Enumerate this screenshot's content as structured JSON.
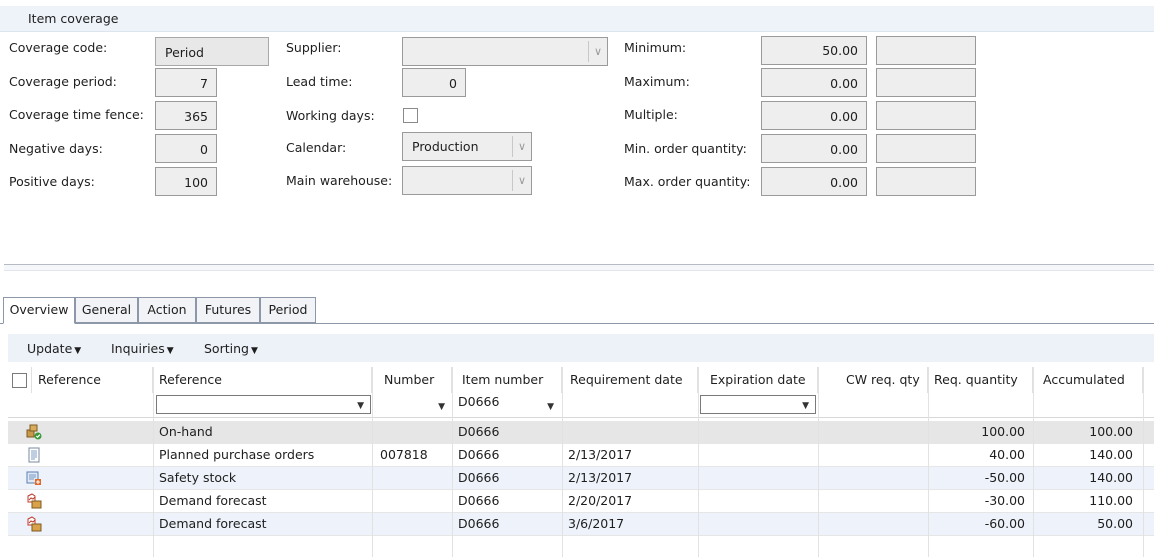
{
  "section": {
    "title": "Item coverage"
  },
  "coverage": {
    "coverage_code_label": "Coverage code:",
    "coverage_code": "Period",
    "coverage_period_label": "Coverage period:",
    "coverage_period": "7",
    "time_fence_label": "Coverage time fence:",
    "time_fence": "365",
    "negative_days_label": "Negative days:",
    "negative_days": "0",
    "positive_days_label": "Positive days:",
    "positive_days": "100"
  },
  "supply": {
    "supplier_label": "Supplier:",
    "supplier": "",
    "lead_time_label": "Lead time:",
    "lead_time": "0",
    "working_days_label": "Working days:",
    "working_days_checked": false,
    "calendar_label": "Calendar:",
    "calendar": "Production",
    "main_warehouse_label": "Main warehouse:",
    "main_warehouse": ""
  },
  "quantities": {
    "minimum_label": "Minimum:",
    "minimum": "50.00",
    "maximum_label": "Maximum:",
    "maximum": "0.00",
    "multiple_label": "Multiple:",
    "multiple": "0.00",
    "min_order_label": "Min. order quantity:",
    "min_order": "0.00",
    "max_order_label": "Max. order quantity:",
    "max_order": "0.00"
  },
  "tabs": [
    {
      "label": "Overview",
      "active": true
    },
    {
      "label": "General"
    },
    {
      "label": "Action"
    },
    {
      "label": "Futures"
    },
    {
      "label": "Period"
    }
  ],
  "toolbar": {
    "update": "Update",
    "inquiries": "Inquiries",
    "sorting": "Sorting"
  },
  "grid": {
    "columns": [
      "Reference",
      "Reference",
      "Number",
      "Item number",
      "Requirement date",
      "Expiration date",
      "CW req. qty",
      "Req. quantity",
      "Accumulated"
    ],
    "filter": {
      "item_number": "D0666"
    },
    "rows": [
      {
        "icon": "on-hand-icon",
        "reference": "On-hand",
        "number": "",
        "item": "D0666",
        "req_date": "",
        "exp_date": "",
        "cw_qty": "",
        "req_qty": "100.00",
        "accumulated": "100.00"
      },
      {
        "icon": "planned-purchase-order-icon",
        "reference": "Planned purchase orders",
        "number": "007818",
        "item": "D0666",
        "req_date": "2/13/2017",
        "exp_date": "",
        "cw_qty": "",
        "req_qty": "40.00",
        "accumulated": "140.00"
      },
      {
        "icon": "safety-stock-icon",
        "reference": "Safety stock",
        "number": "",
        "item": "D0666",
        "req_date": "2/13/2017",
        "exp_date": "",
        "cw_qty": "",
        "req_qty": "-50.00",
        "accumulated": "140.00"
      },
      {
        "icon": "demand-forecast-icon",
        "reference": "Demand forecast",
        "number": "",
        "item": "D0666",
        "req_date": "2/20/2017",
        "exp_date": "",
        "cw_qty": "",
        "req_qty": "-30.00",
        "accumulated": "110.00"
      },
      {
        "icon": "demand-forecast-icon",
        "reference": "Demand forecast",
        "number": "",
        "item": "D0666",
        "req_date": "3/6/2017",
        "exp_date": "",
        "cw_qty": "",
        "req_qty": "-60.00",
        "accumulated": "50.00"
      }
    ]
  }
}
